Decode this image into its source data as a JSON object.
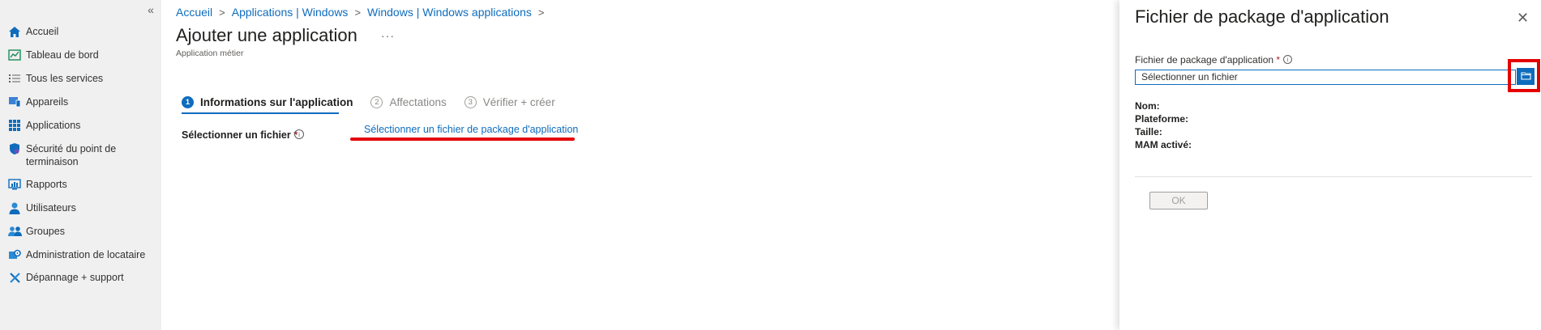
{
  "sidebar": {
    "collapse_glyph": "«",
    "items": [
      {
        "label": "Accueil",
        "icon": "home-icon"
      },
      {
        "label": "Tableau de bord",
        "icon": "dashboard-icon"
      },
      {
        "label": "Tous les services",
        "icon": "list-icon"
      },
      {
        "label": "Appareils",
        "icon": "devices-icon"
      },
      {
        "label": "Applications",
        "icon": "apps-grid-icon"
      },
      {
        "label": "Sécurité du point de terminaison",
        "icon": "shield-icon"
      },
      {
        "label": "Rapports",
        "icon": "reports-icon"
      },
      {
        "label": "Utilisateurs",
        "icon": "user-icon"
      },
      {
        "label": "Groupes",
        "icon": "group-icon"
      },
      {
        "label": "Administration de locataire",
        "icon": "tenant-admin-icon"
      },
      {
        "label": "Dépannage + support",
        "icon": "tools-icon"
      }
    ]
  },
  "breadcrumb": [
    "Accueil",
    "Applications | Windows",
    "Windows | Windows applications"
  ],
  "page": {
    "title": "Ajouter une application",
    "more": "···",
    "subtitle": "Application métier"
  },
  "wizard": {
    "tabs": [
      {
        "num": "1",
        "label": "Informations sur l'application",
        "active": true
      },
      {
        "num": "2",
        "label": "Affectations",
        "active": false
      },
      {
        "num": "3",
        "label": "Vérifier + créer",
        "active": false
      }
    ],
    "select_file_label": "Sélectionner un fichier",
    "required_mark": "*",
    "select_file_link": "Sélectionner un fichier de package d'application"
  },
  "panel": {
    "title": "Fichier de package d'application",
    "close_glyph": "✕",
    "field_label": "Fichier de package d'application",
    "required_mark": "*",
    "input_value": "Sélectionner un fichier",
    "meta": [
      "Nom:",
      "Plateforme:",
      "Taille:",
      "MAM activé:"
    ],
    "ok_label": "OK"
  },
  "colors": {
    "accent": "#0f6cbd",
    "highlight": "#e50000",
    "sidebar_bg": "#f0f0f0"
  }
}
